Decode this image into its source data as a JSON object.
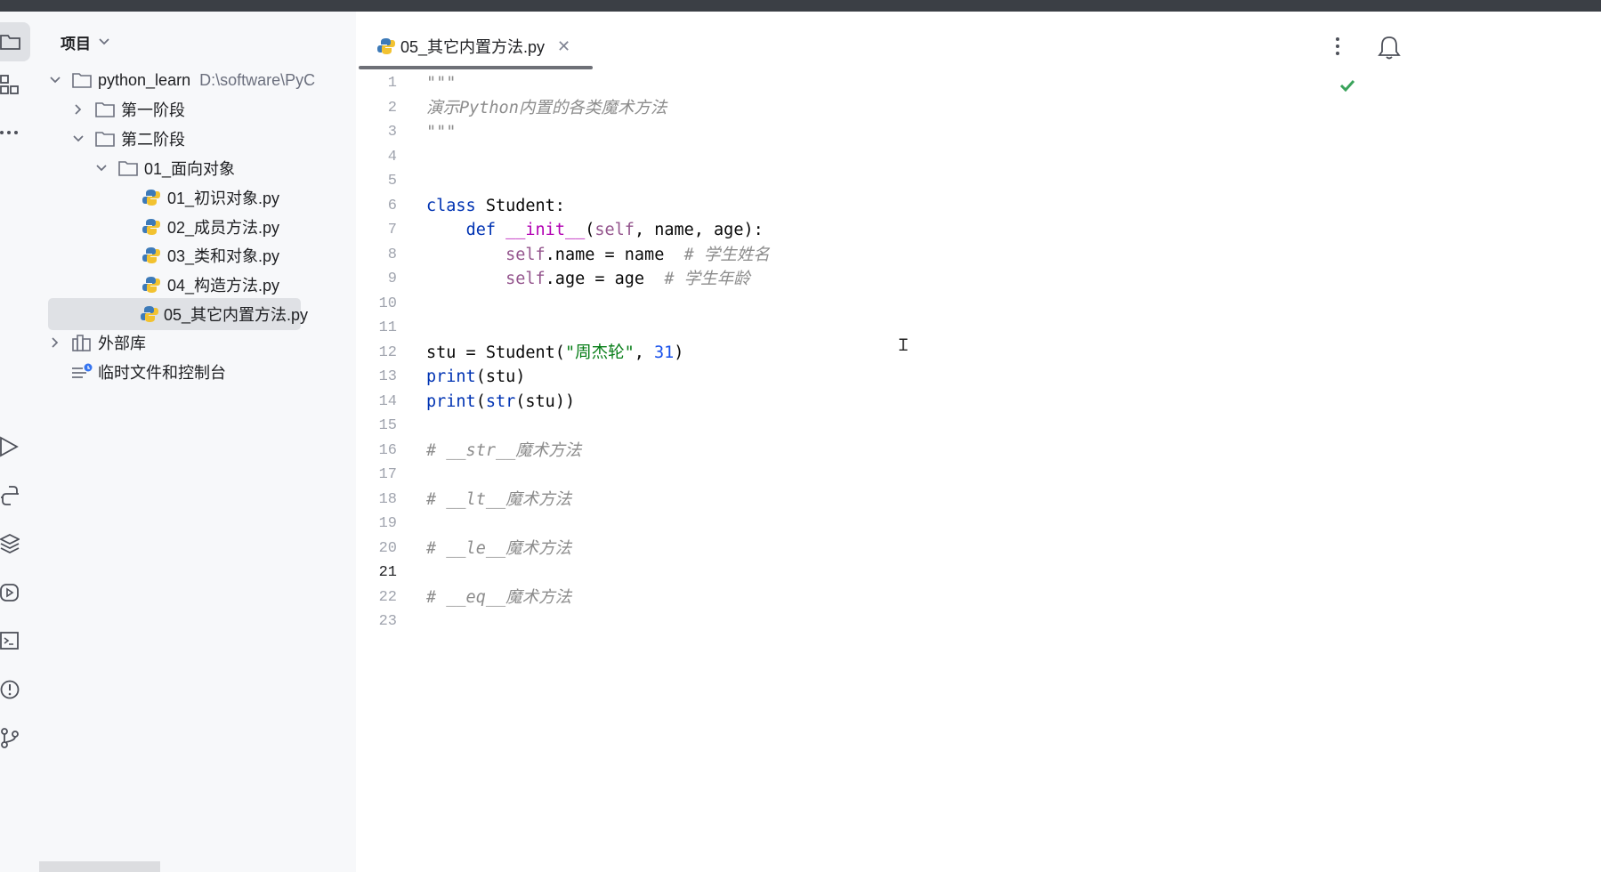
{
  "project_panel": {
    "title": "项目",
    "tree": [
      {
        "label": "python_learn",
        "path": "D:\\software\\PyC"
      },
      {
        "label": "第一阶段"
      },
      {
        "label": "第二阶段"
      },
      {
        "label": "01_面向对象"
      },
      {
        "label": "01_初识对象.py"
      },
      {
        "label": "02_成员方法.py"
      },
      {
        "label": "03_类和对象.py"
      },
      {
        "label": "04_构造方法.py"
      },
      {
        "label": "05_其它内置方法.py"
      },
      {
        "label": "外部库"
      },
      {
        "label": "临时文件和控制台"
      }
    ]
  },
  "editor": {
    "tab_label": "05_其它内置方法.py",
    "current_line": 21,
    "line_numbers": [
      "1",
      "2",
      "3",
      "4",
      "5",
      "6",
      "7",
      "8",
      "9",
      "10",
      "11",
      "12",
      "13",
      "14",
      "15",
      "16",
      "17",
      "18",
      "19",
      "20",
      "21",
      "22",
      "23"
    ],
    "code": {
      "l1": "\"\"\"",
      "l2": "演示Python内置的各类魔术方法",
      "l3": "\"\"\"",
      "l6_kw": "class",
      "l6_rest": " Student:",
      "l7_kw": "def",
      "l7_fn": "__init__",
      "l7_self": "self",
      "l7_rest": ", name, age):",
      "l8_self": "self",
      "l8_rest": ".name = name  ",
      "l8_cmt": "# 学生姓名",
      "l9_self": "self",
      "l9_rest": ".age = age  ",
      "l9_cmt": "# 学生年龄",
      "l12_a": "stu = Student(",
      "l12_str": "\"周杰轮\"",
      "l12_b": ", ",
      "l12_num": "31",
      "l12_c": ")",
      "l13_fn": "print",
      "l13_rest": "(stu)",
      "l14_fn": "print",
      "l14_mid": "(",
      "l14_fn2": "str",
      "l14_rest": "(stu))",
      "l16": "# __str__魔术方法",
      "l18": "# __lt__魔术方法",
      "l20": "# __le__魔术方法",
      "l22": "# __eq__魔术方法"
    }
  },
  "icons": {
    "folder": "folder-icon",
    "python_file": "python-file-icon",
    "library": "library-icon",
    "scratches": "scratches-icon",
    "inspection_ok": "check-icon"
  },
  "colors": {
    "keyword": "#0033b3",
    "self": "#94558d",
    "dunder": "#b200b2",
    "string": "#067d17",
    "number": "#1750eb",
    "comment": "#8c8c8c",
    "selection": "#dfe1e5"
  }
}
